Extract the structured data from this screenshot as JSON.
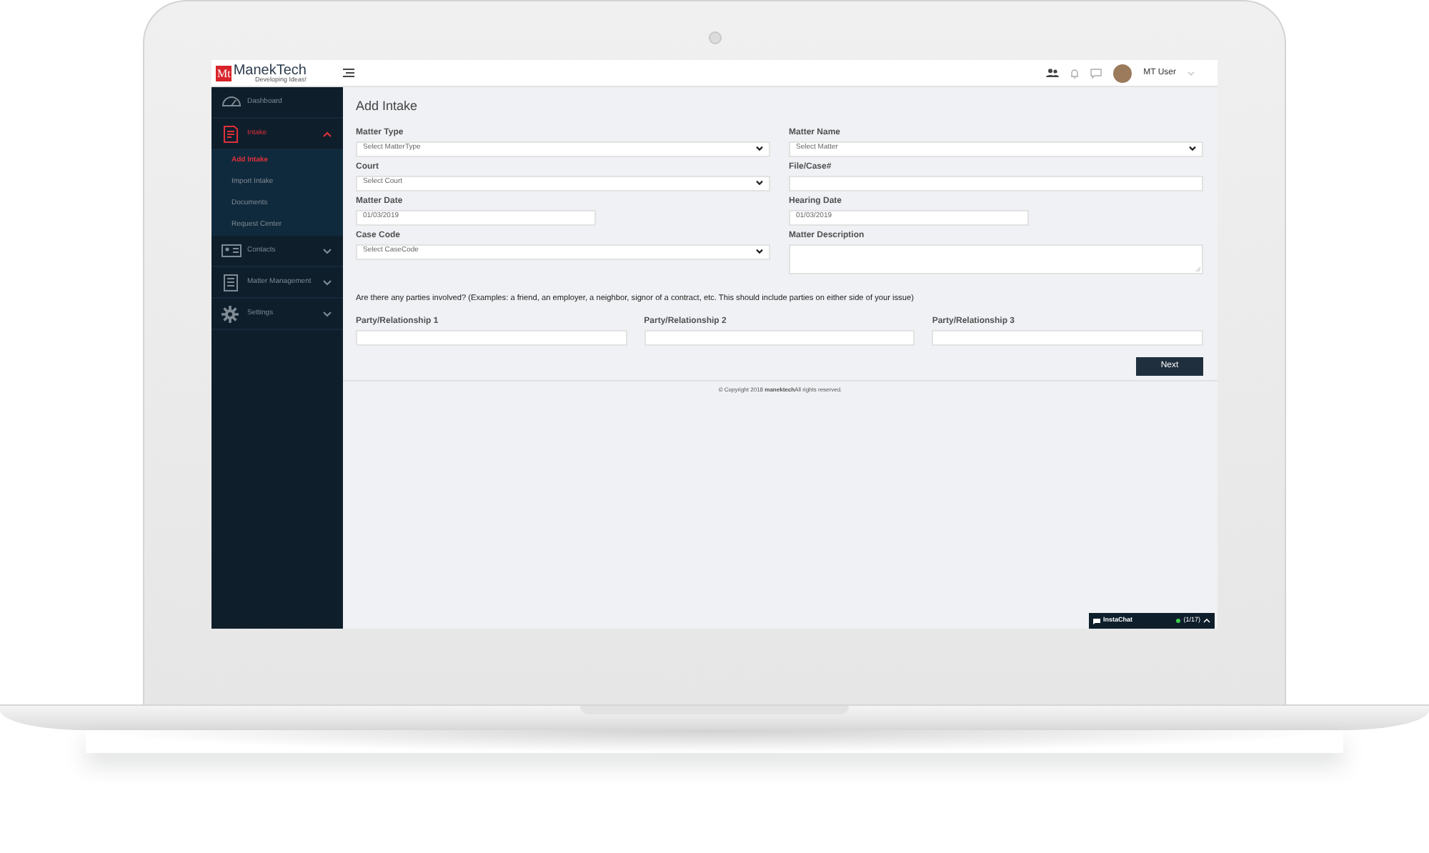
{
  "header": {
    "logo_mark": "Mt",
    "logo_name": "ManekTech",
    "logo_tagline": "Developing Ideas!",
    "user_name": "MT User"
  },
  "sidebar": {
    "items": [
      {
        "label": "Dashboard",
        "selected": false
      },
      {
        "label": "Intake",
        "selected": true,
        "expanded": true,
        "children": [
          {
            "label": "Add Intake",
            "selected": true
          },
          {
            "label": "Import Intake",
            "selected": false
          },
          {
            "label": "Documents",
            "selected": false
          },
          {
            "label": "Request Center",
            "selected": false
          }
        ]
      },
      {
        "label": "Contacts",
        "selected": false,
        "expanded": false
      },
      {
        "label": "Matter Management",
        "selected": false,
        "expanded": false
      },
      {
        "label": "Settings",
        "selected": false,
        "expanded": false
      }
    ]
  },
  "form": {
    "title": "Add Intake",
    "fields": [
      {
        "label": "Matter Type",
        "kind": "select",
        "placeholder": "Select MatterType"
      },
      {
        "label": "Matter Name",
        "kind": "select",
        "placeholder": "Select Matter"
      },
      {
        "label": "Court",
        "kind": "select",
        "placeholder": "Select Court"
      },
      {
        "label": "File/Case#",
        "kind": "text"
      },
      {
        "label": "Matter Date",
        "kind": "date",
        "value": "01/03/2019"
      },
      {
        "label": "Hearing Date",
        "kind": "date",
        "value": "01/03/2019"
      },
      {
        "label": "Case Code",
        "kind": "select",
        "placeholder": "Select CaseCode"
      },
      {
        "label": "Matter Description",
        "kind": "textarea"
      }
    ],
    "parties_prompt": "Are there any parties involved? (Examples: a friend, an employer, a neighbor, signor of a contract, etc. This should include parties on either side of your issue)",
    "parties": [
      {
        "label": "Party/Relationship 1"
      },
      {
        "label": "Party/Relationship 2"
      },
      {
        "label": "Party/Relationship 3"
      }
    ],
    "next_button": "Next"
  },
  "footer": "© Copyright 2018 **manektech**All rights reserved.",
  "chat": {
    "label": "InstaChat",
    "online": true,
    "count": "(1/17)"
  }
}
